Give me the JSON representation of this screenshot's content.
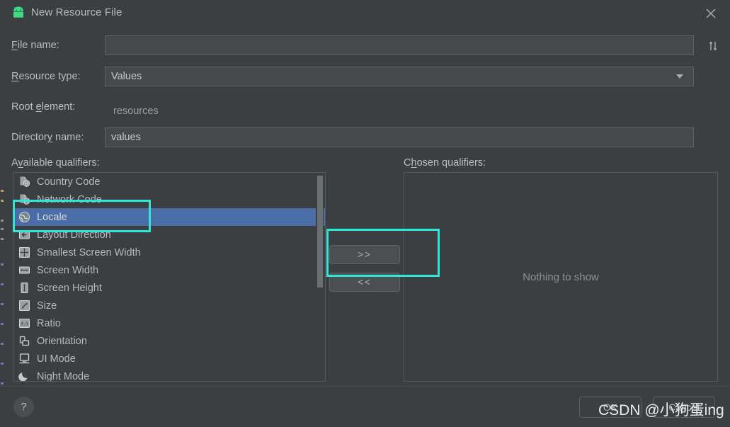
{
  "window": {
    "title": "New Resource File",
    "app_icon": "android-robot-icon",
    "close_icon": "close-icon",
    "swap_icon": "swap-vertical-arrows-icon",
    "accent_teal": "#2ee6d6",
    "selection_blue": "#4a6da7",
    "background": "#3c3f41"
  },
  "form": {
    "file_name": {
      "label_pre": "",
      "label_mnemonic": "F",
      "label_post": "ile name:",
      "value": "",
      "placeholder": ""
    },
    "resource_type": {
      "label_pre": "",
      "label_mnemonic": "R",
      "label_post": "esource type:",
      "value": "Values",
      "dropdown_icon": "chevron-down-icon"
    },
    "root_element": {
      "label_pre": "Root ",
      "label_mnemonic": "e",
      "label_post": "lement:",
      "value": "resources"
    },
    "directory_name": {
      "label_pre": "Director",
      "label_mnemonic": "y",
      "label_post": " name:",
      "value": "values"
    }
  },
  "available": {
    "label_pre": "A",
    "label_mnemonic": "v",
    "label_post": "ailable qualifiers:",
    "items": [
      {
        "label": "Country Code",
        "icon": "country-code-icon",
        "selected": false
      },
      {
        "label": "Network Code",
        "icon": "network-code-icon",
        "selected": false
      },
      {
        "label": "Locale",
        "icon": "locale-globe-icon",
        "selected": true
      },
      {
        "label": "Layout Direction",
        "icon": "layout-direction-icon",
        "selected": false
      },
      {
        "label": "Smallest Screen Width",
        "icon": "smallest-screen-width-icon",
        "selected": false
      },
      {
        "label": "Screen Width",
        "icon": "screen-width-icon",
        "selected": false
      },
      {
        "label": "Screen Height",
        "icon": "screen-height-icon",
        "selected": false
      },
      {
        "label": "Size",
        "icon": "size-icon",
        "selected": false
      },
      {
        "label": "Ratio",
        "icon": "ratio-icon",
        "selected": false
      },
      {
        "label": "Orientation",
        "icon": "orientation-icon",
        "selected": false
      },
      {
        "label": "UI Mode",
        "icon": "ui-mode-icon",
        "selected": false
      },
      {
        "label": "Night Mode",
        "icon": "night-mode-icon",
        "selected": false
      }
    ]
  },
  "transfer": {
    "add_label": ">>",
    "remove_label": "<<"
  },
  "chosen": {
    "label_pre": "C",
    "label_mnemonic": "h",
    "label_post": "osen qualifiers:",
    "empty_message": "Nothing to show",
    "items": []
  },
  "footer": {
    "help_label": "?",
    "ok_label": "OK",
    "cancel_label": "Cancel"
  },
  "watermark": {
    "text": "CSDN @小狗蛋ing"
  }
}
